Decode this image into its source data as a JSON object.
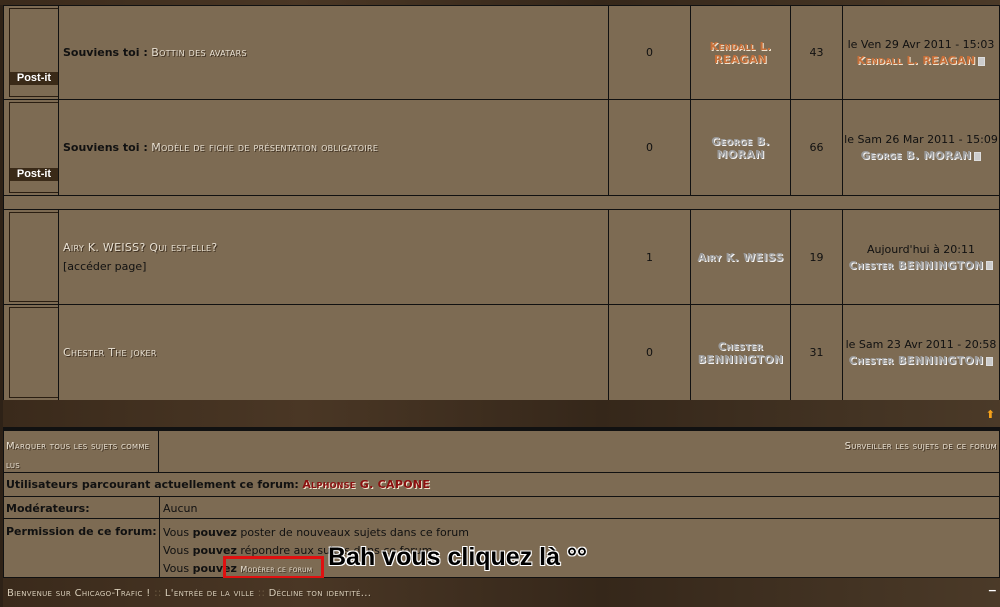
{
  "topics": [
    {
      "prefix": "Souviens toi :",
      "title": "Bottin des avatars",
      "badge": "Post-it",
      "replies": "0",
      "author": "Kendall L. REAGAN",
      "author_color": "#c7703a",
      "views": "43",
      "last_date": "le Ven 29 Avr 2011 - 15:03",
      "last_user": "Kendall L. REAGAN"
    },
    {
      "prefix": "Souviens toi :",
      "title": "Modèle de fiche de présentation obligatoire",
      "badge": "Post-it",
      "replies": "0",
      "author": "George B. MORAN",
      "author_color": "#9a9a9a",
      "views": "66",
      "last_date": "le Sam 26 Mar 2011 - 15:09",
      "last_user": "George B. MORAN"
    },
    {
      "title": "Airy K. WEISS? Qui est-elle?",
      "pages": "[accéder page]",
      "replies": "1",
      "author": "Airy K. WEISS",
      "author_color": "#9a9a9a",
      "views": "19",
      "last_date": "Aujourd'hui à 20:11",
      "last_user": "Chester BENNINGTON"
    },
    {
      "title": "Chester The joker",
      "replies": "0",
      "author": "Chester BENNINGTON",
      "author_color": "#9a9a9a",
      "views": "31",
      "last_date": "le Sam 23 Avr 2011 - 20:58",
      "last_user": "Chester BENNINGTON"
    }
  ],
  "actions": {
    "mark_read": "Marquer tous les sujets comme lus",
    "watch": "Surveiller les sujets de ce forum"
  },
  "browsing": {
    "label": "Utilisateurs parcourant actuellement ce forum:",
    "user": "Alphonse G. CAPONE"
  },
  "moderators": {
    "label": "Modérateurs:",
    "value": "Aucun"
  },
  "permissions": {
    "label": "Permission de ce forum:",
    "vous": "Vous",
    "pouvez": "pouvez",
    "line1": "poster de nouveaux sujets dans ce forum",
    "line2": "répondre aux sujets dans ce forum",
    "moderate_link": "Modérer ce forum"
  },
  "annotation": {
    "text": "Bah vous cliquez là °°",
    "box_color": "#e01010"
  },
  "breadcrumb": {
    "items": [
      "Bienvenue sur Chicago-Trafic !",
      "L'entrée de la ville",
      "Décline ton identité..."
    ],
    "separator": "::"
  },
  "colors": {
    "background": "#7d6b53",
    "moderator_red": "#8b1010"
  }
}
